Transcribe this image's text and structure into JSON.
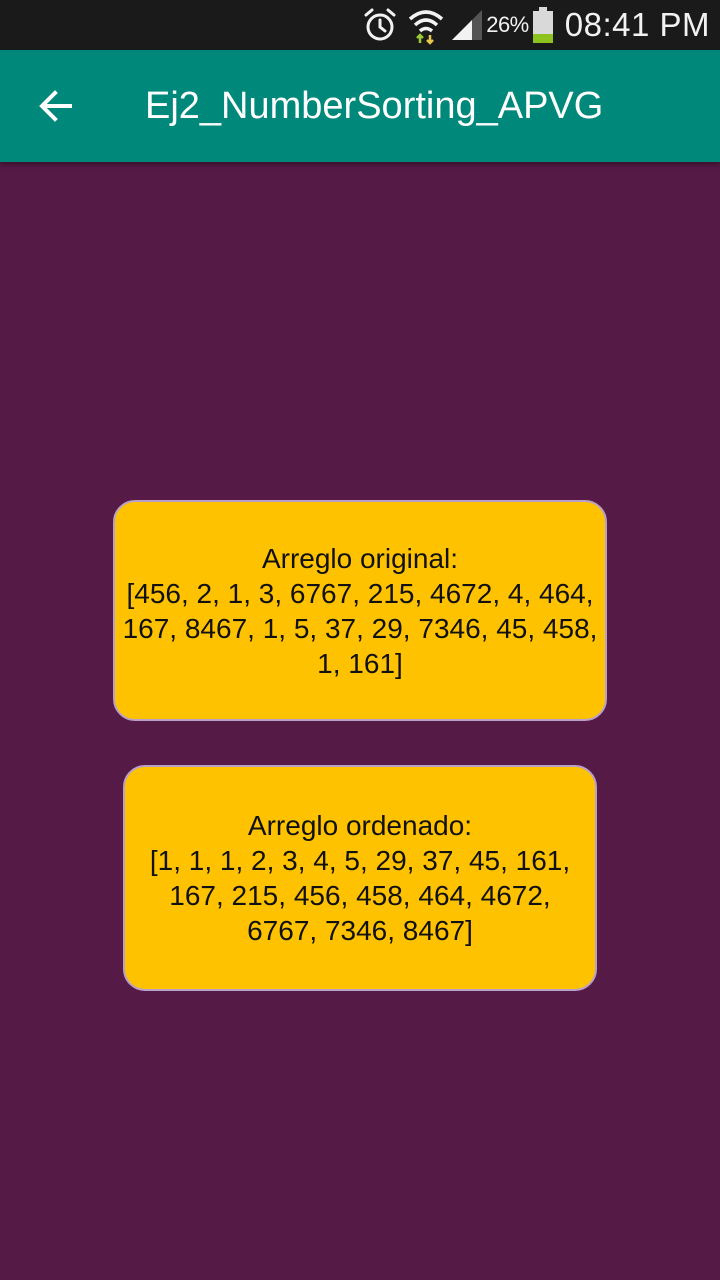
{
  "status_bar": {
    "battery_percent": "26%",
    "time": "08:41 PM",
    "icons": [
      "alarm-icon",
      "wifi-icon",
      "signal-icon",
      "battery-icon"
    ],
    "battery_level": 0.26
  },
  "app_bar": {
    "title": "Ej2_NumberSorting_APVG",
    "back_icon": "arrow-back-icon",
    "color": "#00897b"
  },
  "colors": {
    "background": "#561a47",
    "card": "#ffc200"
  },
  "original": {
    "label": "Arreglo original:",
    "values": "[456, 2, 1, 3, 6767, 215, 4672, 4, 464, 167, 8467, 1, 5, 37, 29, 7346, 45, 458, 1, 161]"
  },
  "sorted": {
    "label": "Arreglo ordenado:",
    "values": "[1, 1, 1, 2, 3, 4, 5, 29, 37, 45, 161, 167, 215, 456, 458, 464, 4672, 6767, 7346, 8467]"
  }
}
